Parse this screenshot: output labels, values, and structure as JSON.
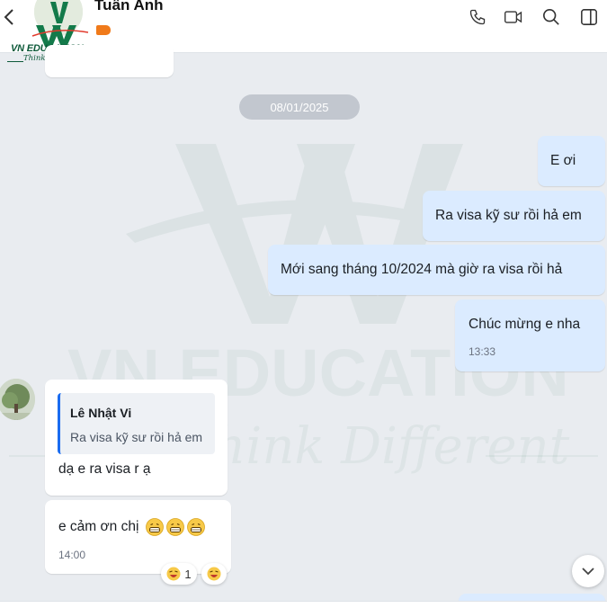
{
  "header": {
    "contact_name": "Tuấn Anh",
    "logo_text": "VN EDUCATION",
    "logo_sub": "Think Different"
  },
  "watermark": {
    "line1": "VN EDUCATION",
    "line2": "Think Different"
  },
  "date_separator": "08/01/2025",
  "messages": {
    "out1": "E ơi",
    "out2": "Ra visa kỹ sư rồi hả em",
    "out3": "Mới sang tháng 10/2024 mà giờ ra visa rồi hả",
    "out4": "Chúc mừng e nha",
    "out4_time": "13:33",
    "in1_quote_name": "Lê Nhật Vi",
    "in1_quote_text": "Ra visa kỹ sư rồi hả em",
    "in1_text": "dạ e ra visa r ạ",
    "in2_text": "e cảm ơn chị",
    "in2_time": "14:00",
    "in2_reaction_count": "1"
  },
  "colors": {
    "outgoing_bubble": "#dbebff",
    "incoming_bubble": "#ffffff",
    "quote_accent": "#1a6cf0",
    "tag": "#f07a1a"
  },
  "icons": [
    "back-chevron-icon",
    "phone-icon",
    "video-call-icon",
    "search-icon",
    "sidebar-toggle-icon",
    "grin-emoji-icon",
    "laughing-reaction-icon",
    "chevron-down-icon"
  ]
}
